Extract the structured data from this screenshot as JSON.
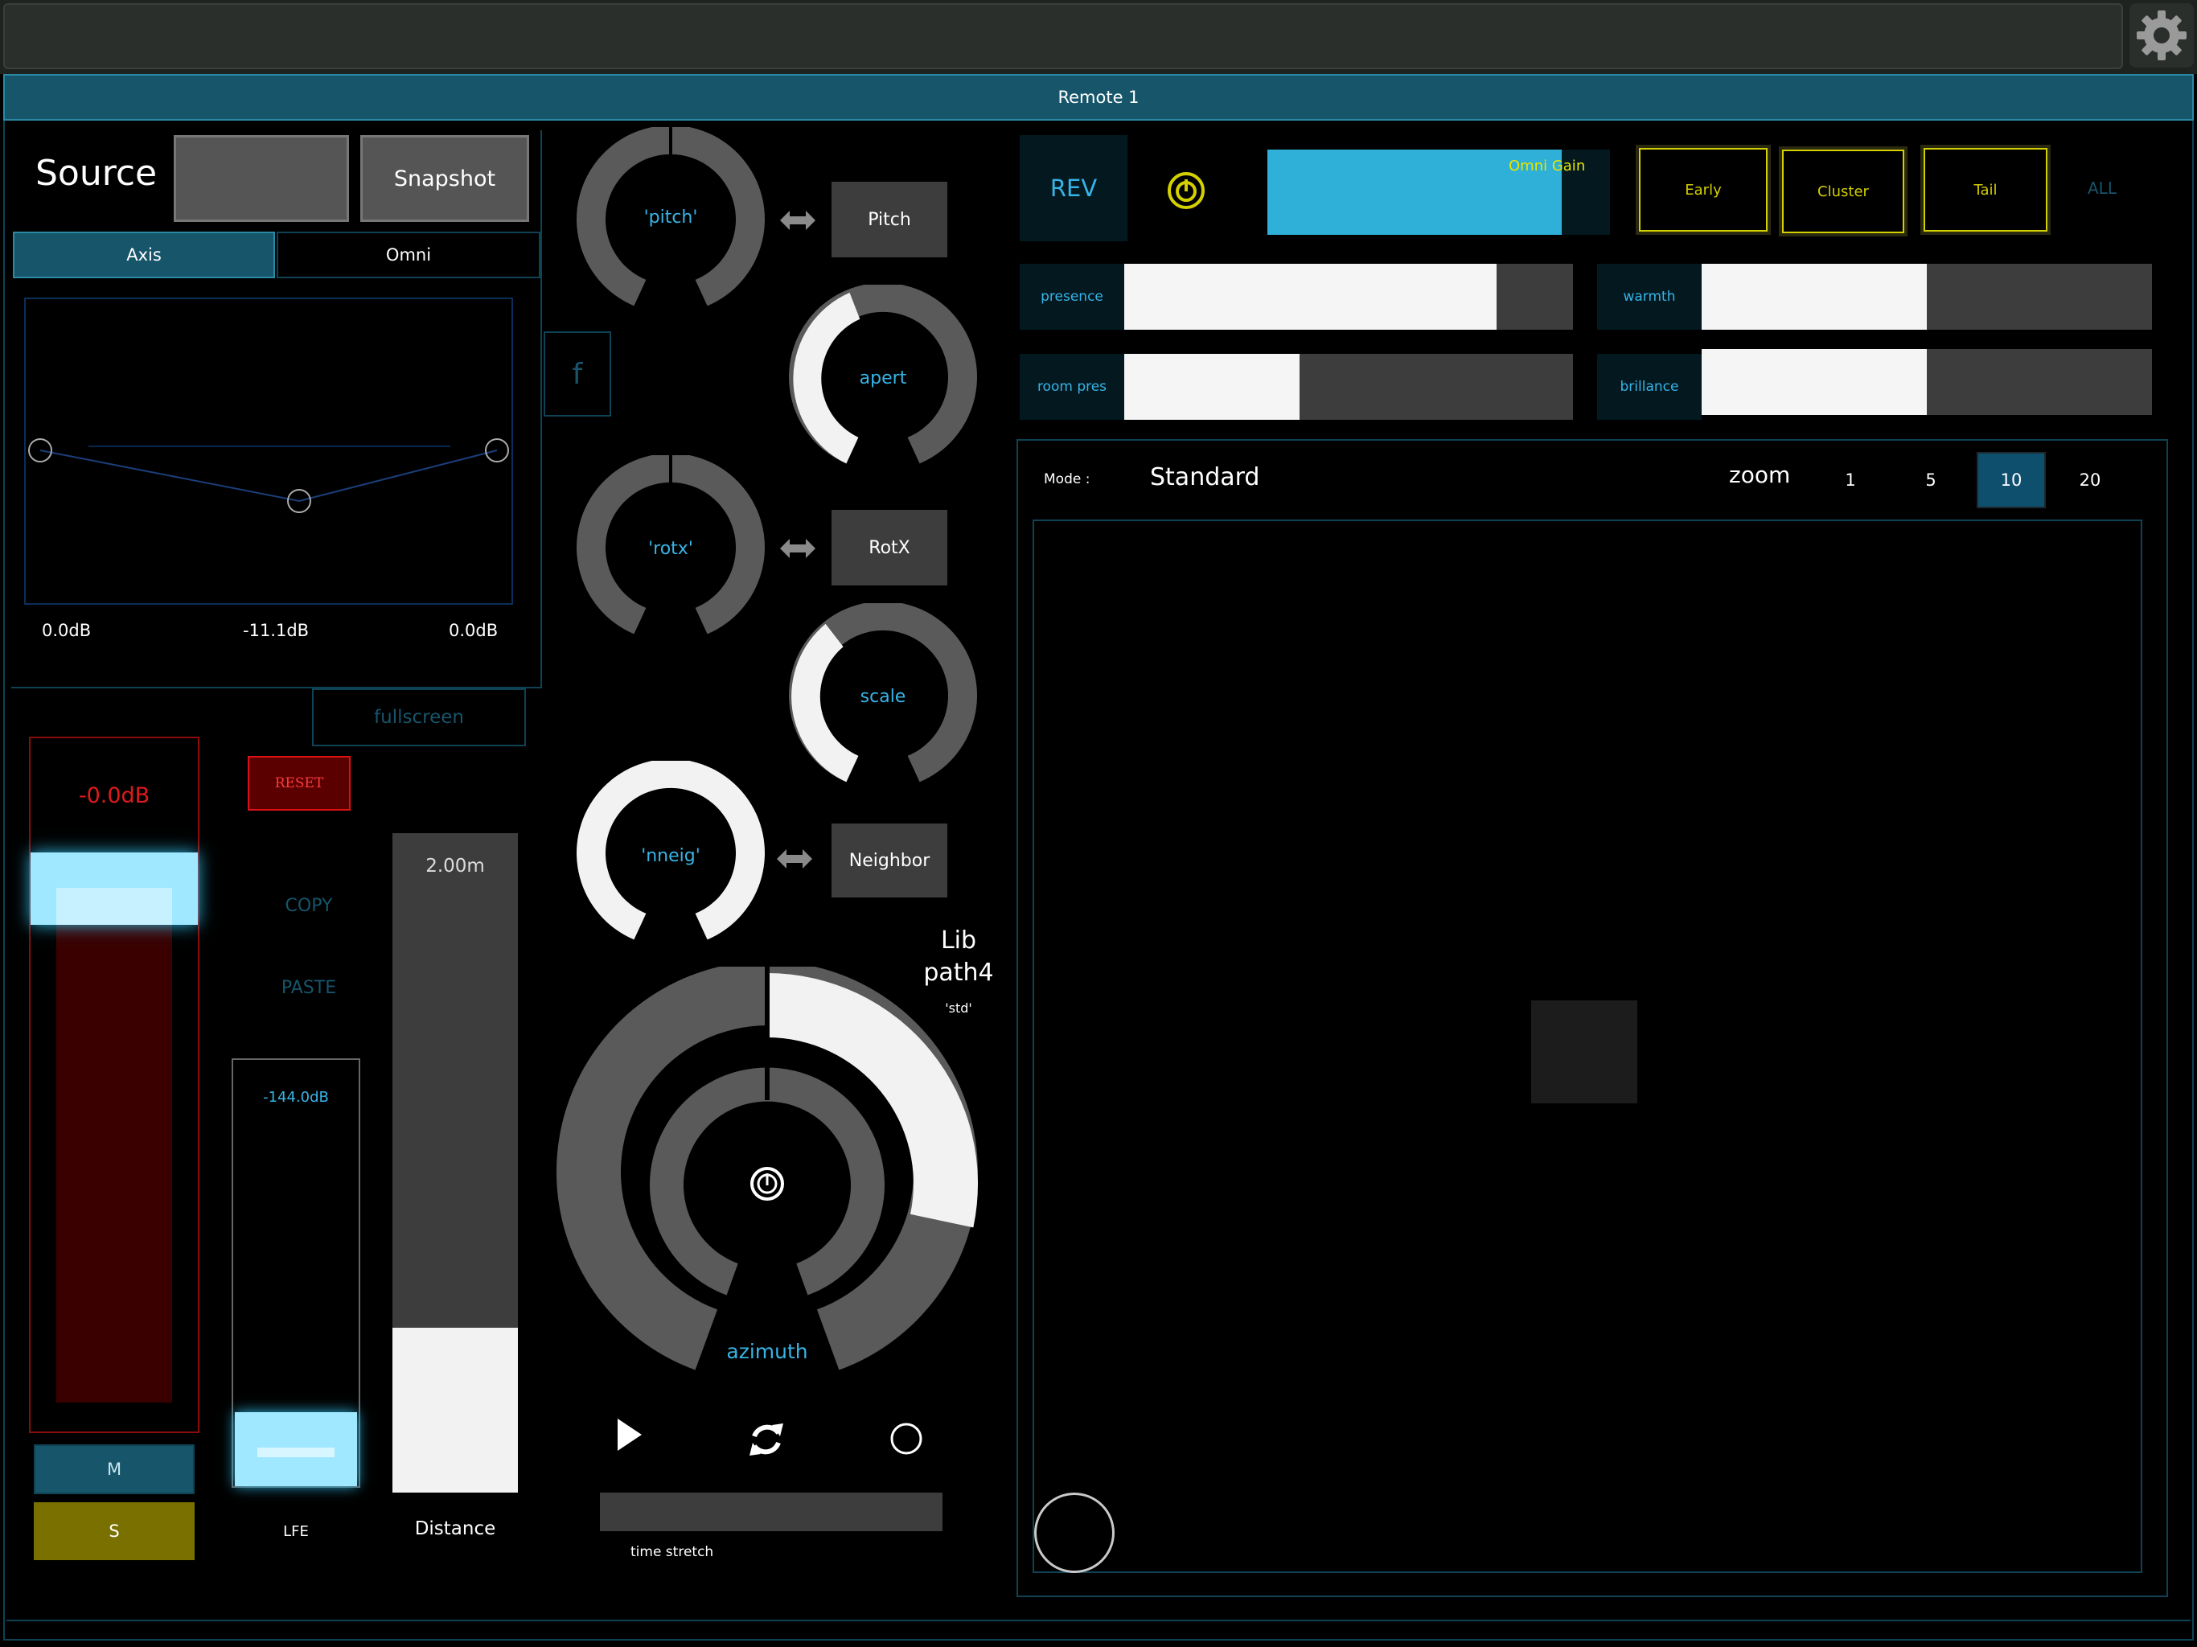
{
  "window": {
    "title": "Remote 1"
  },
  "source": {
    "title": "Source",
    "name_box": "",
    "snapshot_label": "Snapshot",
    "tabs": [
      "Axis",
      "Omni"
    ],
    "axis_values": [
      "0.0dB",
      "-11.1dB",
      "0.0dB"
    ],
    "f_label": "f",
    "fullscreen_label": "fullscreen"
  },
  "level": {
    "value": "-0.0dB",
    "reset_label": "RESET",
    "copy_label": "COPY",
    "paste_label": "PASTE",
    "mute_label": "M",
    "solo_label": "S",
    "lfe_value": "-144.0dB",
    "lfe_label": "LFE",
    "distance_value": "2.00m",
    "distance_label": "Distance",
    "distance_fraction": 0.25
  },
  "knobs": {
    "pitch": {
      "label": "'pitch'",
      "button": "Pitch"
    },
    "apert": {
      "label": "apert"
    },
    "rotx": {
      "label": "'rotx'",
      "button": "RotX"
    },
    "scale": {
      "label": "scale"
    },
    "nneig": {
      "label": "'nneig'",
      "button": "Neighbor"
    },
    "azimuth": {
      "label": "azimuth"
    }
  },
  "lib": {
    "line1": "Lib",
    "line2": "path4",
    "sub": "'std'"
  },
  "transport": {
    "time_stretch_label": "time stretch"
  },
  "rev": {
    "label": "REV",
    "omni_gain_label": "Omni Gain",
    "omni_gain_fraction": 0.86,
    "buttons": [
      "Early",
      "Cluster",
      "Tail"
    ],
    "all_label": "ALL",
    "sliders": [
      {
        "label": "presence",
        "fraction": 0.83
      },
      {
        "label": "warmth",
        "fraction": 0.5
      },
      {
        "label": "room pres",
        "fraction": 0.39
      },
      {
        "label": "brillance",
        "fraction": 0.5
      }
    ]
  },
  "view": {
    "mode_label": "Mode :",
    "mode_value": "Standard",
    "zoom_label": "zoom",
    "zoom_options": [
      "1",
      "5",
      "10",
      "20"
    ],
    "zoom_selected": "10"
  },
  "colors": {
    "accent": "#37b4e6",
    "panel_border": "#0f4254",
    "yellow": "#d4cf00",
    "red": "#b01010"
  }
}
